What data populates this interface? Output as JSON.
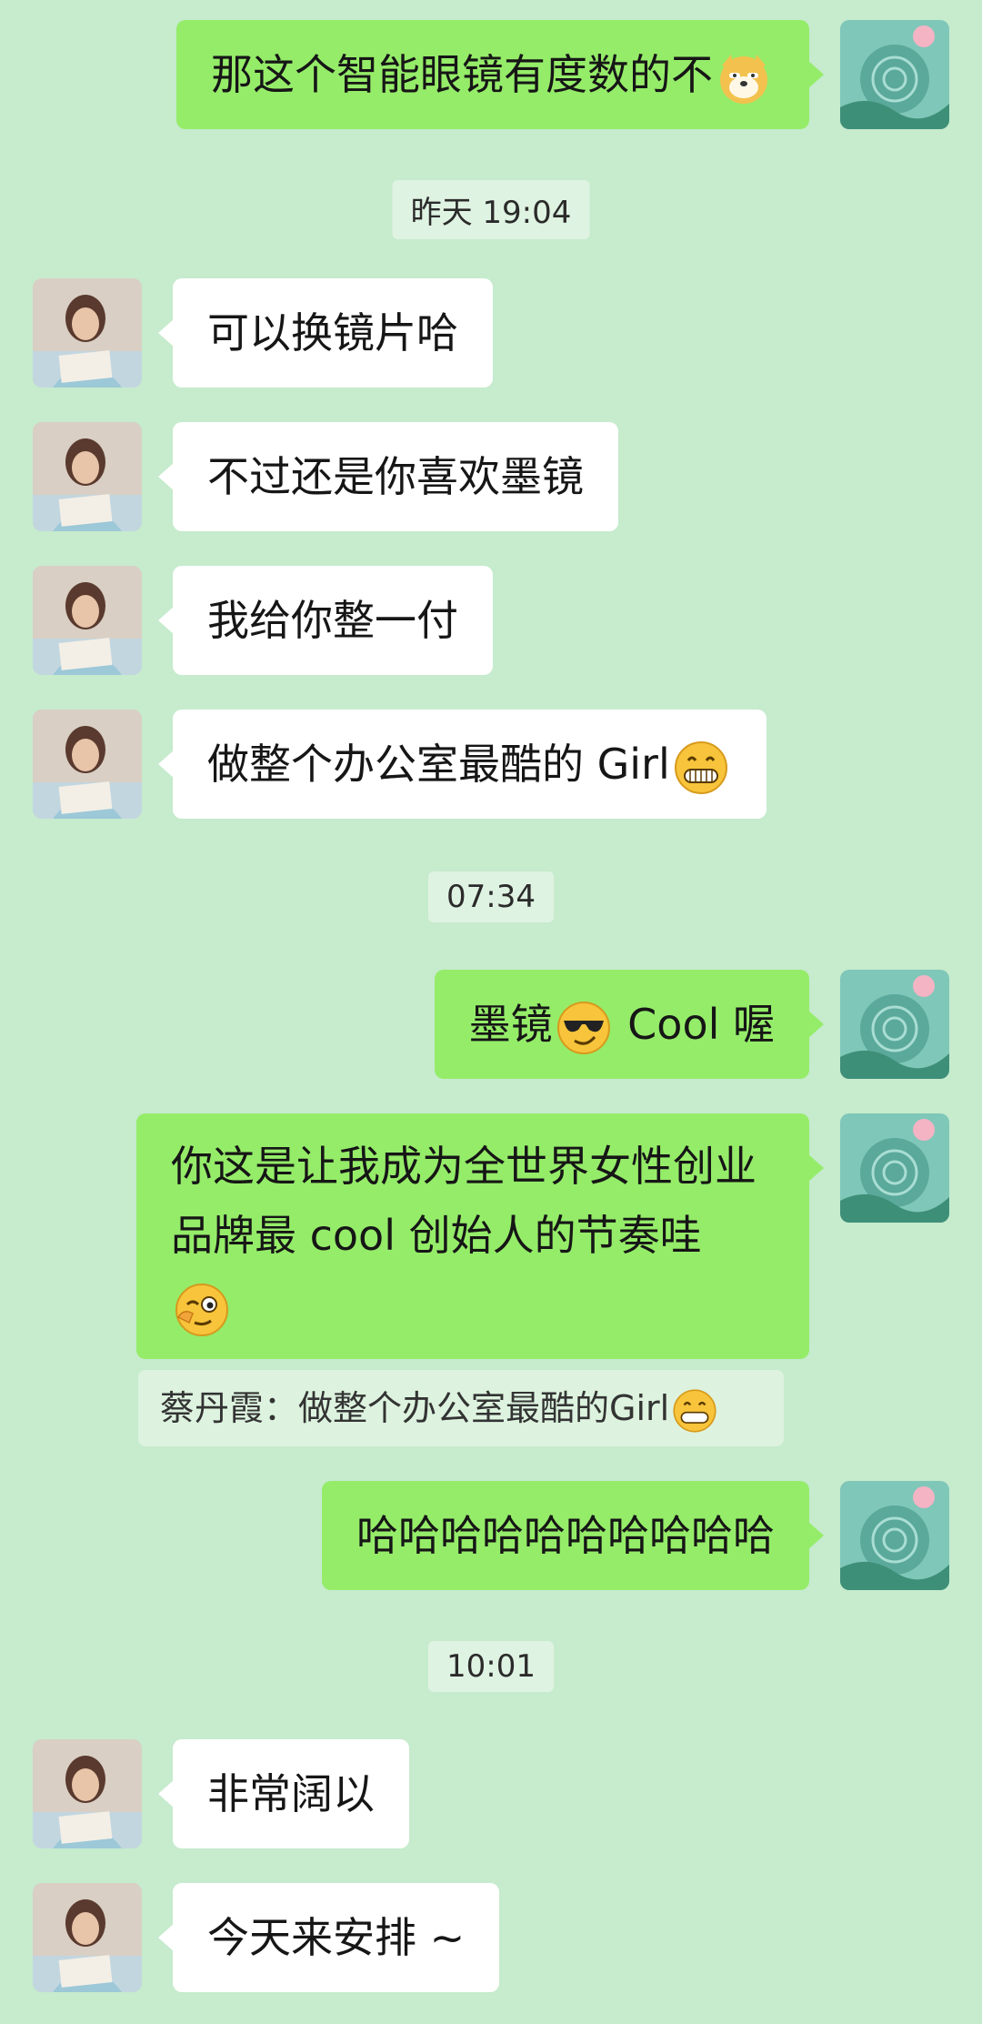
{
  "messages": {
    "m1": "那这个智能眼镜有度数的不",
    "t1": "昨天 19:04",
    "m2": "可以换镜片哈",
    "m3": "不过还是你喜欢墨镜",
    "m4": "我给你整一付",
    "m5": "做整个办公室最酷的 Girl",
    "t2": "07:34",
    "m6_a": "墨镜",
    "m6_b": " Cool 喔",
    "m7": "你这是让我成为全世界女性创业品牌最 cool 创始人的节奏哇",
    "quote": "蔡丹霞：做整个办公室最酷的Girl",
    "m8": "哈哈哈哈哈哈哈哈哈哈",
    "t3": "10:01",
    "m9": "非常阔以",
    "m10": "今天来安排 ~"
  },
  "icons": {
    "dog": "doge-emoji",
    "grin": "grin-emoji",
    "cool": "sunglasses-emoji",
    "wink": "wink-emoji"
  },
  "colors": {
    "background": "#c6ebcd",
    "outgoing_bubble": "#95ec69",
    "incoming_bubble": "#ffffff"
  }
}
